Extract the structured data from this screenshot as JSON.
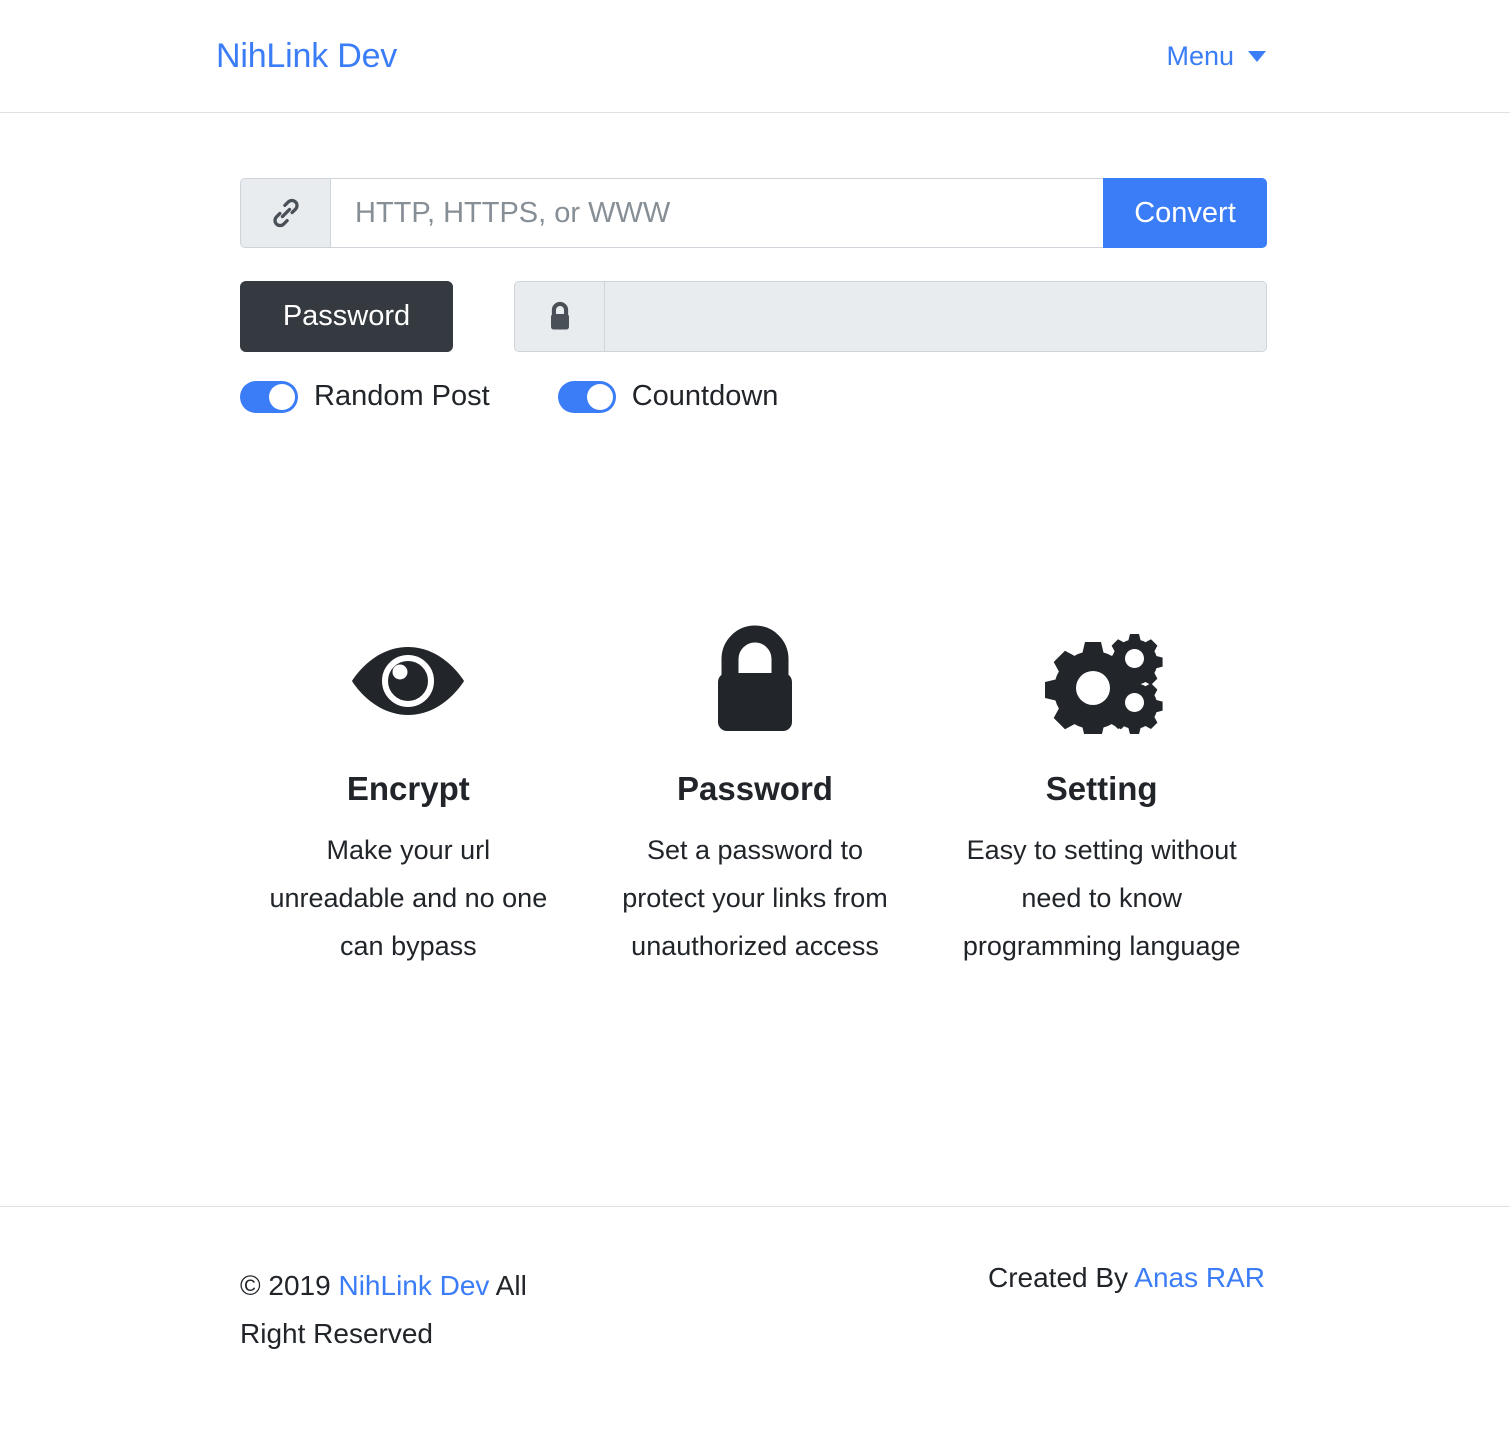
{
  "colors": {
    "brand_blue": "#3b7df7",
    "dark": "#343a40",
    "muted_bg": "#e9ecef",
    "border": "#ced4da",
    "text": "#212529"
  },
  "header": {
    "brand": "NihLink Dev",
    "menu_label": "Menu",
    "menu_icon": "chevron-down-icon"
  },
  "form": {
    "url_icon": "link-icon",
    "url_placeholder": "HTTP, HTTPS, or WWW",
    "url_value": "",
    "convert_label": "Convert",
    "password_button_label": "Password",
    "password_icon": "lock-icon",
    "password_placeholder": "",
    "password_value": "",
    "password_disabled": true,
    "toggles": [
      {
        "label": "Random Post",
        "on": true
      },
      {
        "label": "Countdown",
        "on": true
      }
    ]
  },
  "features": [
    {
      "icon": "eye-icon",
      "title": "Encrypt",
      "desc": "Make your url unreadable and no one can bypass"
    },
    {
      "icon": "lock-icon",
      "title": "Password",
      "desc": "Set a password to protect your links from unauthorized access"
    },
    {
      "icon": "cogs-icon",
      "title": "Setting",
      "desc": "Easy to setting without need to know programming language"
    }
  ],
  "footer": {
    "copyright_prefix": "© 2019 ",
    "copyright_link": "NihLink Dev",
    "copyright_suffix": " All Right Reserved",
    "created_prefix": "Created By ",
    "created_link": "Anas RAR"
  }
}
